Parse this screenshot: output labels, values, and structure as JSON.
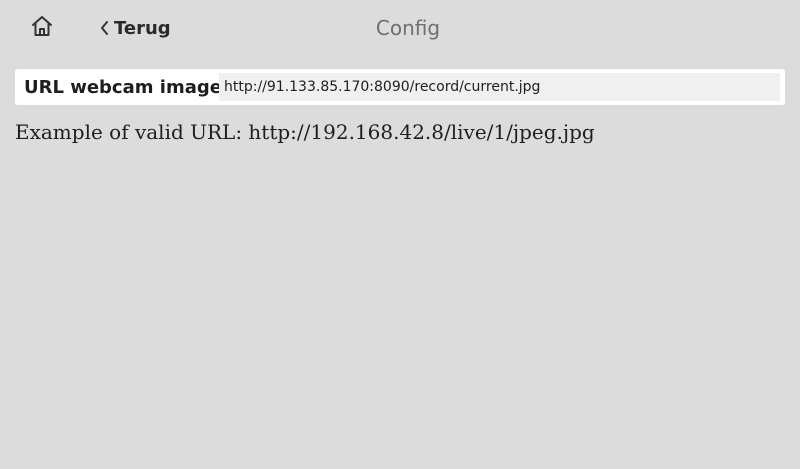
{
  "header": {
    "home_icon": "home-icon",
    "back_icon": "chevron-left-icon",
    "back_label": "Terug",
    "title": "Config"
  },
  "settings": {
    "webcam_url": {
      "label": "URL webcam image",
      "value": "http://91.133.85.170:8090/record/current.jpg"
    },
    "hint": "Example of valid URL: http://192.168.42.8/live/1/jpeg.jpg"
  }
}
